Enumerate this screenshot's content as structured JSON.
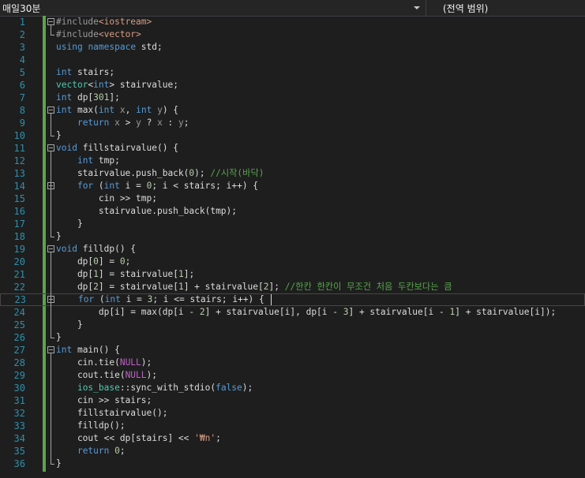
{
  "toolbar": {
    "project_dropdown": "매일30분",
    "scope_dropdown": "(전역 범위)"
  },
  "editor": {
    "lines": [
      {
        "n": "1",
        "t": [
          [
            "pp",
            "#include"
          ],
          [
            "str",
            "<iostream>"
          ]
        ]
      },
      {
        "n": "2",
        "t": [
          [
            "pp",
            "#include"
          ],
          [
            "str",
            "<vector>"
          ]
        ]
      },
      {
        "n": "3",
        "t": [
          [
            "kw",
            "using"
          ],
          [
            "",
            " "
          ],
          [
            "kw",
            "namespace"
          ],
          [
            "",
            " std;"
          ]
        ]
      },
      {
        "n": "4",
        "t": []
      },
      {
        "n": "5",
        "t": [
          [
            "kw",
            "int"
          ],
          [
            "",
            " stairs;"
          ]
        ]
      },
      {
        "n": "6",
        "t": [
          [
            "ty",
            "vector"
          ],
          [
            "",
            "<"
          ],
          [
            "kw",
            "int"
          ],
          [
            "",
            "> stairvalue;"
          ]
        ]
      },
      {
        "n": "7",
        "t": [
          [
            "kw",
            "int"
          ],
          [
            "",
            " dp["
          ],
          [
            "num",
            "301"
          ],
          [
            "",
            "];"
          ]
        ]
      },
      {
        "n": "8",
        "t": [
          [
            "kw",
            "int"
          ],
          [
            "",
            " max("
          ],
          [
            "kw",
            "int"
          ],
          [
            "",
            " "
          ],
          [
            "param",
            "x"
          ],
          [
            "",
            ", "
          ],
          [
            "kw",
            "int"
          ],
          [
            "",
            " "
          ],
          [
            "param",
            "y"
          ],
          [
            "",
            ") {"
          ]
        ]
      },
      {
        "n": "9",
        "t": [
          [
            "",
            "    "
          ],
          [
            "kw",
            "return"
          ],
          [
            "",
            " "
          ],
          [
            "param",
            "x"
          ],
          [
            "",
            " > "
          ],
          [
            "param",
            "y"
          ],
          [
            "",
            " ? "
          ],
          [
            "param",
            "x"
          ],
          [
            "",
            " : "
          ],
          [
            "param",
            "y"
          ],
          [
            "",
            ";"
          ]
        ]
      },
      {
        "n": "10",
        "t": [
          [
            "",
            "}"
          ]
        ]
      },
      {
        "n": "11",
        "t": [
          [
            "kw",
            "void"
          ],
          [
            "",
            " fillstairvalue() {"
          ]
        ]
      },
      {
        "n": "12",
        "t": [
          [
            "",
            "    "
          ],
          [
            "kw",
            "int"
          ],
          [
            "",
            " tmp;"
          ]
        ]
      },
      {
        "n": "13",
        "t": [
          [
            "",
            "    stairvalue.push_back("
          ],
          [
            "num",
            "0"
          ],
          [
            "",
            "); "
          ],
          [
            "cm",
            "//시작(바닥)"
          ]
        ]
      },
      {
        "n": "14",
        "t": [
          [
            "",
            "    "
          ],
          [
            "kw",
            "for"
          ],
          [
            "",
            " ("
          ],
          [
            "kw",
            "int"
          ],
          [
            "",
            " i = "
          ],
          [
            "num",
            "0"
          ],
          [
            "",
            "; i < stairs; i++) {"
          ]
        ]
      },
      {
        "n": "15",
        "t": [
          [
            "",
            "        cin >> tmp;"
          ]
        ]
      },
      {
        "n": "16",
        "t": [
          [
            "",
            "        stairvalue.push_back(tmp);"
          ]
        ]
      },
      {
        "n": "17",
        "t": [
          [
            "",
            "    }"
          ]
        ]
      },
      {
        "n": "18",
        "t": [
          [
            "",
            "}"
          ]
        ]
      },
      {
        "n": "19",
        "t": [
          [
            "kw",
            "void"
          ],
          [
            "",
            " filldp() {"
          ]
        ]
      },
      {
        "n": "20",
        "t": [
          [
            "",
            "    dp["
          ],
          [
            "num",
            "0"
          ],
          [
            "",
            "] = "
          ],
          [
            "num",
            "0"
          ],
          [
            "",
            ";"
          ]
        ]
      },
      {
        "n": "21",
        "t": [
          [
            "",
            "    dp["
          ],
          [
            "num",
            "1"
          ],
          [
            "",
            "] = stairvalue["
          ],
          [
            "num",
            "1"
          ],
          [
            "",
            "];"
          ]
        ]
      },
      {
        "n": "22",
        "t": [
          [
            "",
            "    dp["
          ],
          [
            "num",
            "2"
          ],
          [
            "",
            "] = stairvalue["
          ],
          [
            "num",
            "1"
          ],
          [
            "",
            "] + stairvalue["
          ],
          [
            "num",
            "2"
          ],
          [
            "",
            "]; "
          ],
          [
            "cm",
            "//한칸 한칸이 무조건 처음 두칸보다는 큼"
          ]
        ]
      },
      {
        "n": "23",
        "t": [
          [
            "",
            "    "
          ],
          [
            "kw",
            "for"
          ],
          [
            "",
            " ("
          ],
          [
            "kw",
            "int"
          ],
          [
            "",
            " i = "
          ],
          [
            "num",
            "3"
          ],
          [
            "",
            "; i <= stairs; i++) {"
          ]
        ]
      },
      {
        "n": "24",
        "t": [
          [
            "",
            "        dp[i] = max(dp[i - "
          ],
          [
            "num",
            "2"
          ],
          [
            "",
            "] + stairvalue[i], dp[i - "
          ],
          [
            "num",
            "3"
          ],
          [
            "",
            "] + stairvalue[i - "
          ],
          [
            "num",
            "1"
          ],
          [
            "",
            "] + stairvalue[i]);"
          ]
        ]
      },
      {
        "n": "25",
        "t": [
          [
            "",
            "    }"
          ]
        ]
      },
      {
        "n": "26",
        "t": [
          [
            "",
            "}"
          ]
        ]
      },
      {
        "n": "27",
        "t": [
          [
            "kw",
            "int"
          ],
          [
            "",
            " main() {"
          ]
        ]
      },
      {
        "n": "28",
        "t": [
          [
            "",
            "    cin.tie("
          ],
          [
            "mac",
            "NULL"
          ],
          [
            "",
            ");"
          ]
        ]
      },
      {
        "n": "29",
        "t": [
          [
            "",
            "    cout.tie("
          ],
          [
            "mac",
            "NULL"
          ],
          [
            "",
            ");"
          ]
        ]
      },
      {
        "n": "30",
        "t": [
          [
            "",
            "    "
          ],
          [
            "ty",
            "ios_base"
          ],
          [
            "",
            "::sync_with_stdio("
          ],
          [
            "kw",
            "false"
          ],
          [
            "",
            ");"
          ]
        ]
      },
      {
        "n": "31",
        "t": [
          [
            "",
            "    cin >> stairs;"
          ]
        ]
      },
      {
        "n": "32",
        "t": [
          [
            "",
            "    fillstairvalue();"
          ]
        ]
      },
      {
        "n": "33",
        "t": [
          [
            "",
            "    filldp();"
          ]
        ]
      },
      {
        "n": "34",
        "t": [
          [
            "",
            "    cout << dp[stairs] << "
          ],
          [
            "str",
            "'₩n'"
          ],
          [
            "",
            ";"
          ]
        ]
      },
      {
        "n": "35",
        "t": [
          [
            "",
            "    "
          ],
          [
            "kw",
            "return"
          ],
          [
            "",
            " "
          ],
          [
            "num",
            "0"
          ],
          [
            "",
            ";"
          ]
        ]
      },
      {
        "n": "36",
        "t": [
          [
            "",
            "}"
          ]
        ]
      }
    ]
  }
}
